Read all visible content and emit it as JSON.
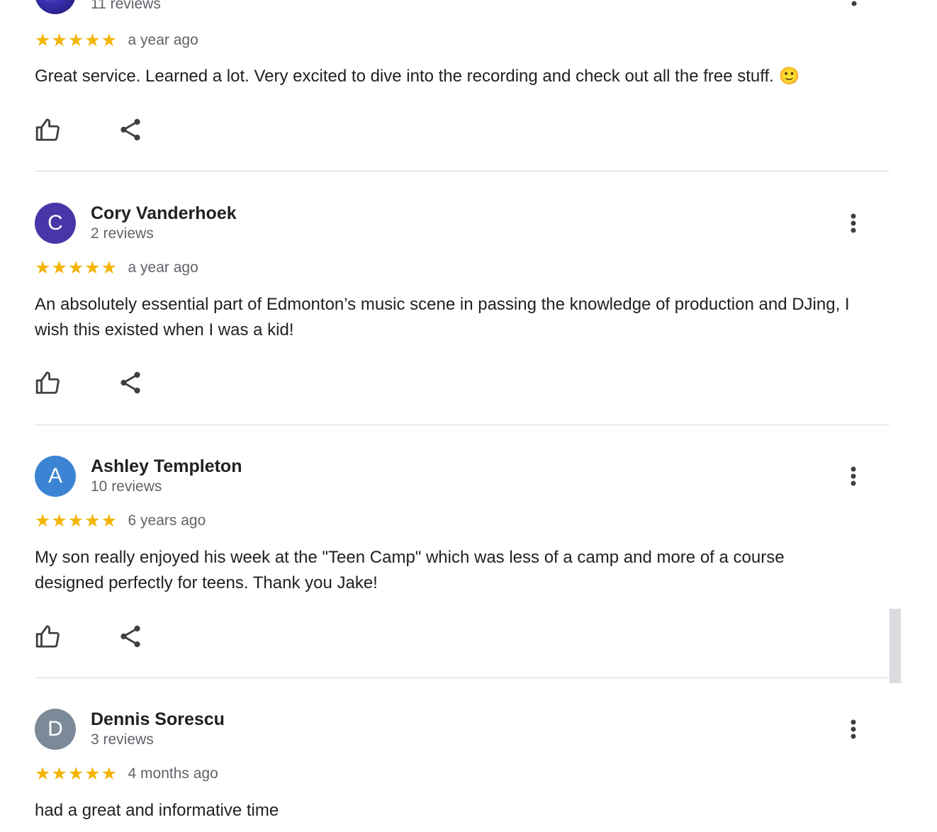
{
  "reviews": [
    {
      "name": "",
      "count": "11 reviews",
      "stars": "★★★★★",
      "date": "a year ago",
      "text": "Great service. Learned a lot. Very excited to dive into the recording and check out all the free stuff. 🙂"
    },
    {
      "initial": "C",
      "avatar_color": "#4a35a8",
      "name": "Cory Vanderhoek",
      "count": "2 reviews",
      "stars": "★★★★★",
      "date": "a year ago",
      "text": "An absolutely essential part of Edmonton’s music scene in passing the knowledge of production and DJing, I wish this existed when I was a kid!"
    },
    {
      "initial": "A",
      "avatar_color": "#3b84d4",
      "name": "Ashley Templeton",
      "count": "10 reviews",
      "stars": "★★★★★",
      "date": "6 years ago",
      "text": "My son really enjoyed his week at the \"Teen Camp\" which was less of a camp and more of a course designed perfectly for teens. Thank you Jake!"
    },
    {
      "initial": "D",
      "avatar_color": "#7b8a98",
      "name": "Dennis Sorescu",
      "count": "3 reviews",
      "stars": "★★★★★",
      "date": "4 months ago",
      "text": "had a great and informative time"
    }
  ],
  "icons": {
    "like": "thumbs-up-icon",
    "share": "share-icon",
    "more": "more-vertical-icon"
  },
  "colors": {
    "star": "#f4b400",
    "secondary_text": "#5f6368",
    "divider": "#dadce0"
  }
}
